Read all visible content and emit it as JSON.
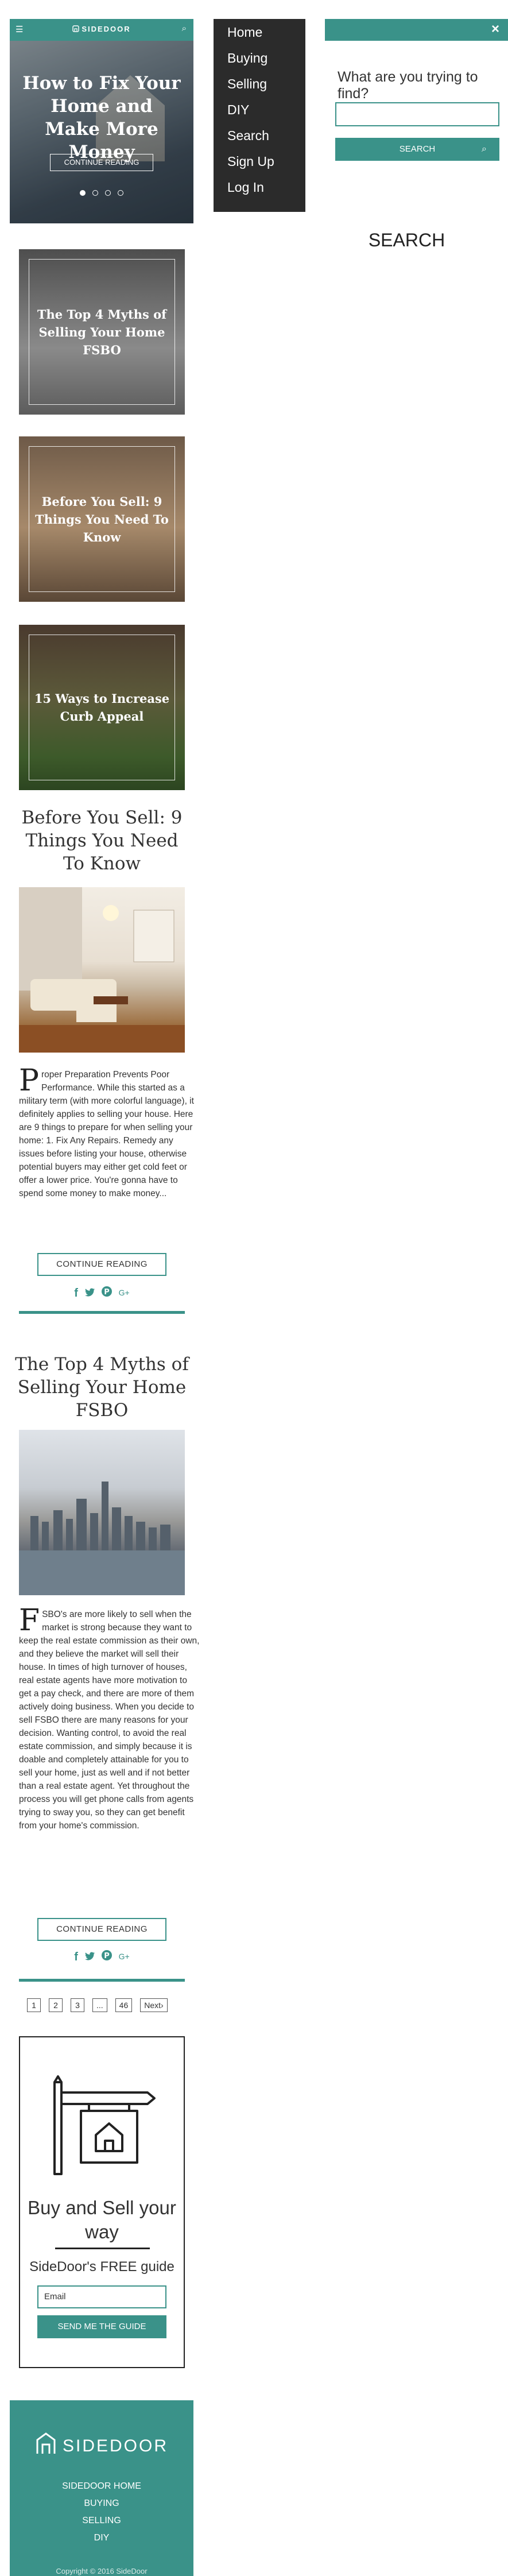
{
  "header": {
    "logo": "SIDEDOOR",
    "menu_icon": "☰",
    "search_icon": "⌕"
  },
  "hero": {
    "title": "How to Fix Your Home and Make More Money",
    "cta": "CONTINUE READING",
    "slides": 4
  },
  "cards": [
    {
      "title": "The Top 4 Myths of Selling Your Home FSBO"
    },
    {
      "title": "Before You Sell: 9 Things You Need To Know"
    },
    {
      "title": "15 Ways to Increase Curb Appeal"
    }
  ],
  "posts": [
    {
      "title": "Before You Sell: 9 Things You Need To Know",
      "dropcap": "P",
      "excerpt": "roper Preparation Prevents Poor Performance. While this started as a military term (with more colorful language), it definitely applies to selling your house. Here are 9 things to prepare for when selling your home: 1. Fix Any Repairs. Remedy any issues before listing your house, otherwise potential buyers may either get cold feet or offer a lower price. You're gonna have to spend some money to make money...",
      "cta": "CONTINUE READING"
    },
    {
      "title": "The Top 4 Myths of Selling Your Home FSBO",
      "dropcap": "F",
      "excerpt": "SBO's are more likely to sell when the market is strong because they want to keep the real estate commission as their own, and they believe the market will sell their house. In times of high turnover of houses, real estate agents have more motivation to get a pay check, and there are more of them actively doing business. When you decide to sell FSBO there are many reasons for your decision. Wanting control, to avoid the real estate commission, and simply because it is doable and completely attainable for you to sell your home, just as well and if not better than a real estate agent. Yet throughout the process you will get phone calls from agents trying to sway you, so they can get benefit from your home's commission.",
      "cta": "CONTINUE READING"
    }
  ],
  "share_icons": [
    "f",
    "t",
    "p",
    "G+"
  ],
  "pagination": [
    "1",
    "2",
    "3",
    "...",
    "46",
    "Next›"
  ],
  "guide": {
    "title": "Buy and Sell your way",
    "subtitle": "SideDoor's FREE guide",
    "email_placeholder": "Email",
    "button": "SEND ME THE GUIDE"
  },
  "footer": {
    "brand": "SIDEDOOR",
    "links": [
      "SIDEDOOR HOME",
      "BUYING",
      "SELLING",
      "DIY"
    ],
    "copyright": "Copyright © 2016 SideDoor"
  },
  "nav": {
    "items": [
      "Home",
      "Buying",
      "Selling",
      "DIY",
      "Search",
      "Sign Up",
      "Log In"
    ]
  },
  "search": {
    "close": "×",
    "question": "What are you trying to find?",
    "button": "SEARCH",
    "heading": "SEARCH"
  },
  "colors": {
    "accent": "#3a9289",
    "nav_bg": "#2b2b2b"
  }
}
